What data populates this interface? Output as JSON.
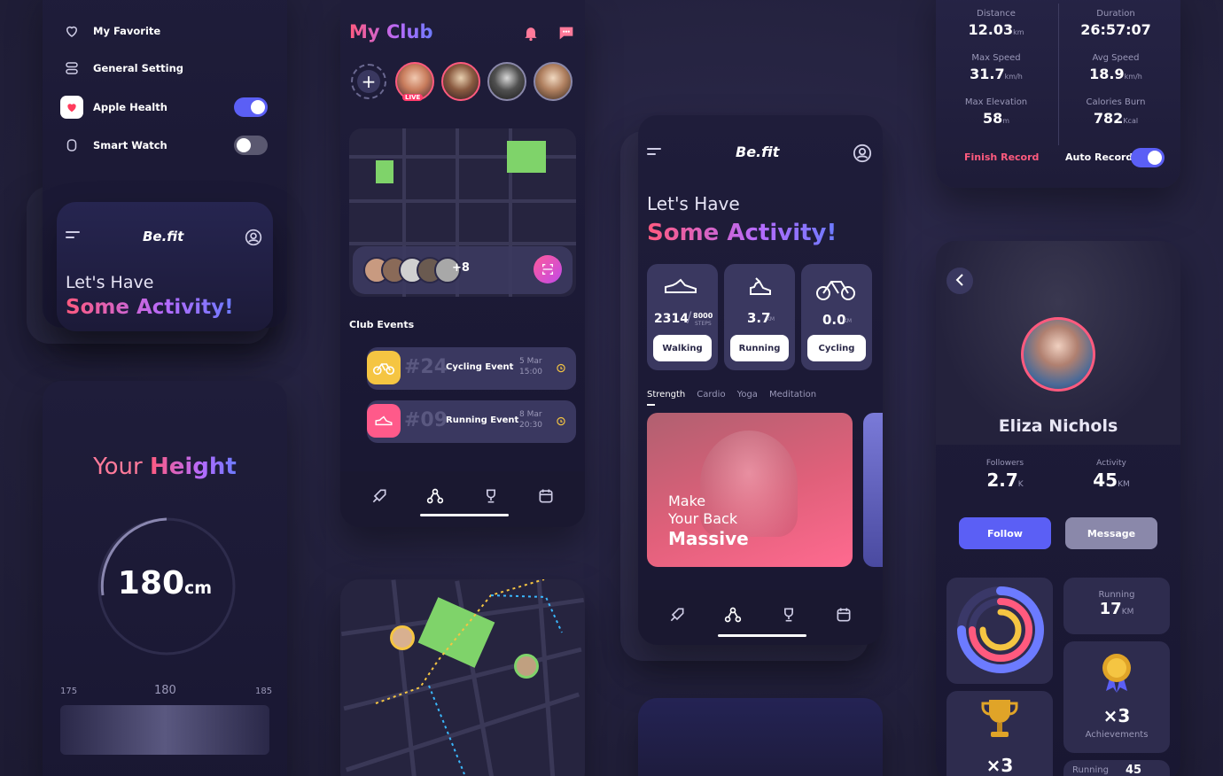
{
  "settings_card": {
    "items": [
      {
        "label": "My Favorite",
        "icon": "heart-icon"
      },
      {
        "label": "General Setting",
        "icon": "settings-icon"
      },
      {
        "label": "Apple Health",
        "icon": "apple-health-icon",
        "toggle": true
      },
      {
        "label": "Smart Watch",
        "icon": "watch-icon",
        "toggle": false
      }
    ]
  },
  "mini_home": {
    "logo": "Be.fit",
    "greeting": "Let's Have",
    "headline": "Some Activity!"
  },
  "height_card": {
    "title_prefix": "Your",
    "title_emphasis": "Height",
    "value": "180",
    "unit": "cm",
    "ruler": {
      "min": "175",
      "mid": "180",
      "max": "185"
    }
  },
  "club_card": {
    "title": "My Club",
    "live_badge": "LIVE",
    "participants_more": "+8",
    "section_title": "Club Events",
    "events": [
      {
        "number": "#24",
        "name": "Cycling Event",
        "date": "5 Mar",
        "time": "15:00",
        "color": "#f5c542"
      },
      {
        "number": "#09",
        "name": "Running Event",
        "date": "8 Mar",
        "time": "20:30",
        "color": "#ff5a8a"
      }
    ]
  },
  "activity_card": {
    "logo": "Be.fit",
    "greeting": "Let's Have",
    "headline": "Some Activity!",
    "stats": [
      {
        "value": "2314",
        "sub": "8000",
        "sub_unit": "STEPS",
        "label": "Walking",
        "icon": "shoe-icon"
      },
      {
        "value": "3.7",
        "unit": "KM",
        "label": "Running",
        "icon": "sneaker-icon"
      },
      {
        "value": "0.0",
        "unit": "KM",
        "label": "Cycling",
        "icon": "bicycle-icon"
      }
    ],
    "tabs": [
      "Strength",
      "Cardio",
      "Yoga",
      "Meditation"
    ],
    "promo": {
      "line1": "Make",
      "line2": "Your Back",
      "line3": "Massive"
    }
  },
  "record_card": {
    "metrics": [
      {
        "label": "Distance",
        "value": "12.03",
        "unit": "km"
      },
      {
        "label": "Duration",
        "value": "26:57:07",
        "unit": ""
      },
      {
        "label": "Max Speed",
        "value": "31.7",
        "unit": "km/h"
      },
      {
        "label": "Avg Speed",
        "value": "18.9",
        "unit": "km/h"
      },
      {
        "label": "Max Elevation",
        "value": "58",
        "unit": "m"
      },
      {
        "label": "Calories Burn",
        "value": "782",
        "unit": "Kcal"
      }
    ],
    "finish": "Finish Record",
    "auto": "Auto Record"
  },
  "profile_card": {
    "name": "Eliza Nichols",
    "followers_label": "Followers",
    "followers_value": "2.7",
    "followers_unit": "K",
    "activity_label": "Activity",
    "activity_value": "45",
    "activity_unit": "KM",
    "follow_btn": "Follow",
    "message_btn": "Message",
    "running_label": "Running",
    "running_value": "17",
    "running_unit": "KM",
    "achievements_count": "×3",
    "achievements_label": "Achievements",
    "trophy_count": "×3",
    "bottom_label": "Running",
    "bottom_value": "45"
  },
  "colors": {
    "accent": "#5b5ff5",
    "pink": "#ff5a7e",
    "green_block": "#7fd36a",
    "card": "#1f1d3a"
  }
}
